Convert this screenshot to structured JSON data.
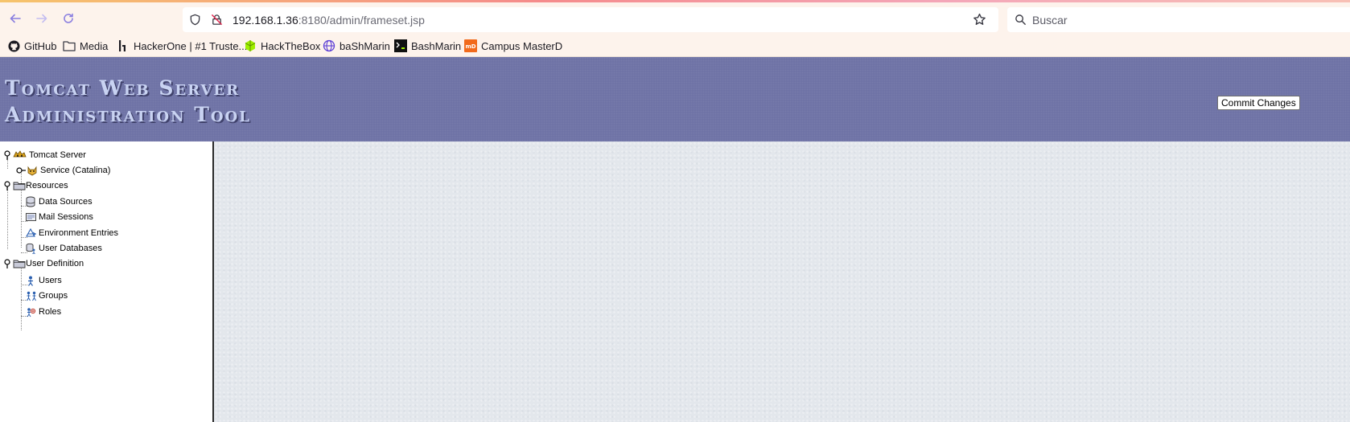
{
  "browser": {
    "url_host": "192.168.1.36",
    "url_rest": ":8180/admin/frameset.jsp",
    "search_placeholder": "Buscar"
  },
  "bookmarks": [
    {
      "label": "GitHub",
      "icon": "github-icon"
    },
    {
      "label": "Media",
      "icon": "folder-icon"
    },
    {
      "label": "HackerOne | #1 Truste...",
      "icon": "hackerone-icon"
    },
    {
      "label": "HackTheBox",
      "icon": "hackthebox-icon"
    },
    {
      "label": "baShMarin",
      "icon": "globe-icon"
    },
    {
      "label": "BashMarin",
      "icon": "terminal-icon"
    },
    {
      "label": "Campus MasterD",
      "icon": "masterd-icon"
    }
  ],
  "banner": {
    "title_line1": "Tomcat Web Server",
    "title_line2": "Administration Tool",
    "commit_label": "Commit Changes"
  },
  "tree": {
    "server": "Tomcat Server",
    "service": "Service (Catalina)",
    "resources": "Resources",
    "data_sources": "Data Sources",
    "mail_sessions": "Mail Sessions",
    "environment_entries": "Environment Entries",
    "user_databases": "User Databases",
    "user_definition": "User Definition",
    "users": "Users",
    "groups": "Groups",
    "roles": "Roles"
  },
  "colors": {
    "banner": "#6f73a6",
    "banner_text": "#c9d3f2",
    "content_bg": "#e3e7ec",
    "toolbar_bg": "#fdf3ec"
  }
}
